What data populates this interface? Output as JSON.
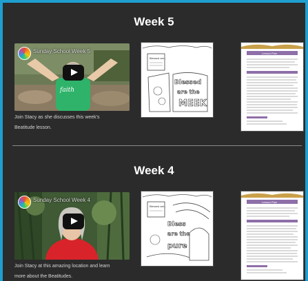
{
  "weeks": [
    {
      "heading": "Week 5",
      "video": {
        "title": "Sunday School Week 5",
        "caption_line1": "Join Stacy as she discusses this week's",
        "caption_line2": "Beatitude lesson."
      },
      "coloring_page": {
        "header": "Blessed are...",
        "big_text": "Blessed are the MEEK"
      },
      "lesson_doc": {
        "header": "Lesson Plan"
      }
    },
    {
      "heading": "Week 4",
      "video": {
        "title": "Sunday School Week 4",
        "caption_line1": "Join Stacy at this amazing location and learn",
        "caption_line2": "more about the Beatitudes."
      },
      "coloring_page": {
        "header": "Blessed are...",
        "big_text": "Blessed are the pure"
      },
      "lesson_doc": {
        "header": "Lesson Plan"
      }
    }
  ],
  "colors": {
    "page_bg": "#2b2b2b",
    "outer_border": "#1f9fd0",
    "doc_accent": "#8e6fa8"
  },
  "icons": [
    "play-icon",
    "sunday-school-logo-icon"
  ]
}
